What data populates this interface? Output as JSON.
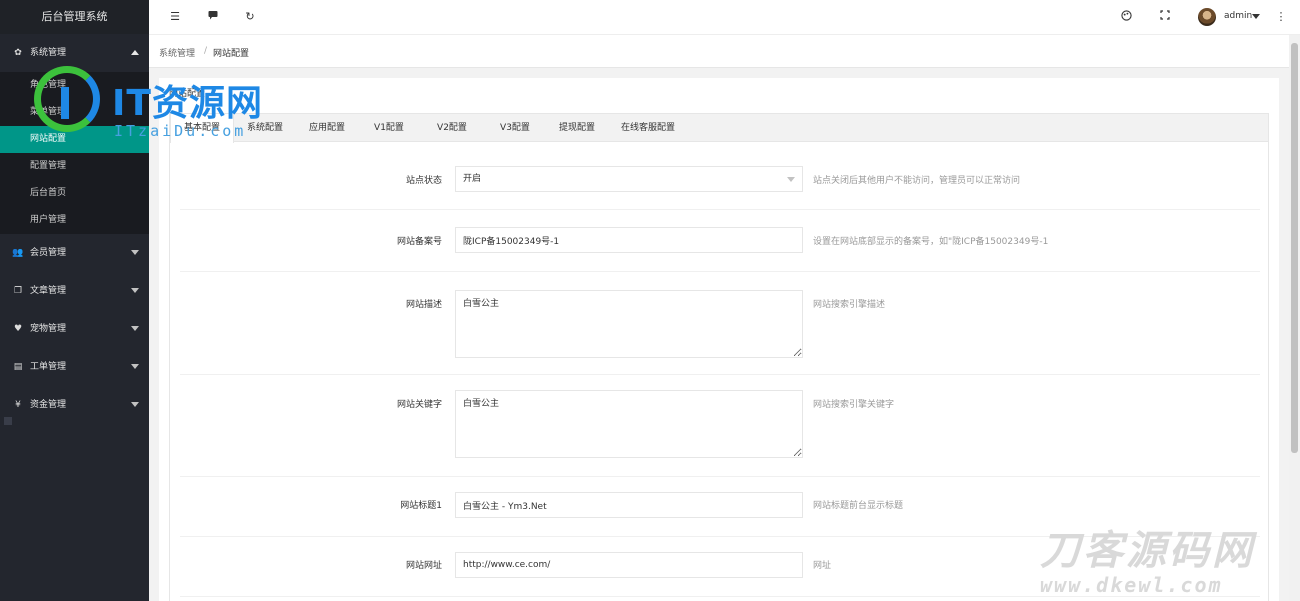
{
  "app": {
    "title": "后台管理系统"
  },
  "sidebar": {
    "groups": [
      {
        "label": "系统管理",
        "icon": "gear-icon",
        "expanded": true,
        "items": [
          {
            "label": "角色管理"
          },
          {
            "label": "菜单管理"
          },
          {
            "label": "网站配置",
            "active": true
          },
          {
            "label": "配置管理"
          },
          {
            "label": "后台首页"
          },
          {
            "label": "用户管理"
          }
        ]
      },
      {
        "label": "会员管理",
        "icon": "users-icon"
      },
      {
        "label": "文章管理",
        "icon": "copy-icon"
      },
      {
        "label": "宠物管理",
        "icon": "heart-icon"
      },
      {
        "label": "工单管理",
        "icon": "file-icon"
      },
      {
        "label": "资金管理",
        "icon": "yen-icon"
      }
    ]
  },
  "header": {
    "icons": [
      "menu-toggle-icon",
      "message-icon",
      "refresh-icon",
      "theme-icon",
      "fullscreen-icon",
      "more-icon"
    ],
    "user": "admin"
  },
  "breadcrumb": [
    "系统管理",
    "网站配置"
  ],
  "card": {
    "title": "网站配置"
  },
  "tabs": [
    "基本配置",
    "系统配置",
    "应用配置",
    "V1配置",
    "V2配置",
    "V3配置",
    "提现配置",
    "在线客服配置"
  ],
  "form": {
    "site_status": {
      "label": "站点状态",
      "value": "开启",
      "help": "站点关闭后其他用户不能访问，管理员可以正常访问"
    },
    "icp": {
      "label": "网站备案号",
      "value": "陇ICP备15002349号-1",
      "help": "设置在网站底部显示的备案号，如\"陇ICP备15002349号-1"
    },
    "description": {
      "label": "网站描述",
      "value": "白雪公主",
      "help": "网站搜索引擎描述"
    },
    "keywords": {
      "label": "网站关键字",
      "value": "白雪公主",
      "help": "网站搜索引擎关键字"
    },
    "title1": {
      "label": "网站标题1",
      "value": "白雪公主 - Ym3.Net",
      "help": "网站标题前台显示标题"
    },
    "url": {
      "label": "网站网址",
      "value": "http://www.ce.com/",
      "help": "网址"
    }
  },
  "watermarks": {
    "top_title": "IT资源网",
    "top_sub": "ITzaiDu.com",
    "bottom_big": "刀客源码网",
    "bottom_small": "www.dkewl.com"
  },
  "colors": {
    "sidebar_bg": "#23262e",
    "active_item": "#009688"
  }
}
